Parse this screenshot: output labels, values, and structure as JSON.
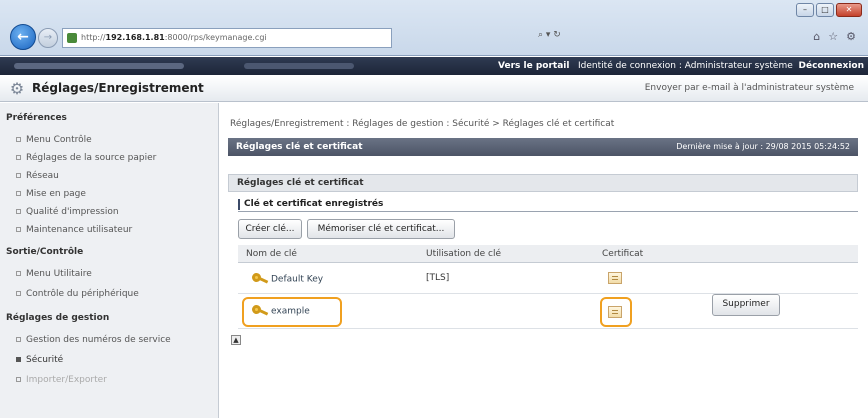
{
  "browser": {
    "url_prefix": "http://",
    "url_host": "192.168.1.81",
    "url_rest": ":8000/rps/keymanage.cgi",
    "address_tools": "⌕ ▾ ↻",
    "window_min": "–",
    "window_max": "□",
    "window_close": "✕",
    "back": "←",
    "forward": "→",
    "tools": [
      "⌂",
      "☆",
      "⚙"
    ]
  },
  "topbar": {
    "portal_link": "Vers le portail",
    "identity_label": "Identité de connexion : Administrateur système",
    "logout": "Déconnexion"
  },
  "titlebar": {
    "title": "Réglages/Enregistrement",
    "mail_link": "Envoyer par e-mail à l'administrateur système",
    "icon": "gear-icon"
  },
  "sidebar": {
    "categories": [
      {
        "label": "Préférences",
        "items": [
          "Menu Contrôle",
          "Réglages de la source papier",
          "Réseau",
          "Mise en page",
          "Qualité d'impression",
          "Maintenance utilisateur"
        ]
      },
      {
        "label": "Sortie/Contrôle",
        "items": [
          "Menu Utilitaire",
          "Contrôle du périphérique"
        ]
      },
      {
        "label": "Réglages de gestion",
        "items": [
          "Gestion des numéros de service",
          "Sécurité",
          "Importer/Exporter"
        ]
      }
    ]
  },
  "main": {
    "breadcrumb": "Réglages/Enregistrement : Réglages de gestion : Sécurité > Réglages clé et certificat",
    "header_title": "Réglages clé et certificat",
    "last_update": "Dernière mise à jour : 29/08 2015 05:24:52",
    "sub_header": "Réglages clé et certificat",
    "group_title": "Clé et certificat enregistrés",
    "create_button": "Créer clé...",
    "memorize_button": "Mémoriser clé et certificat...",
    "table": {
      "headers": [
        "Nom de clé",
        "Utilisation de clé",
        "Certificat"
      ],
      "rows": [
        {
          "name": "Default Key",
          "usage": "[TLS]"
        },
        {
          "name": "example",
          "usage": ""
        }
      ]
    },
    "delete_button": "Supprimer",
    "collapse_symbol": "▲"
  },
  "colors": {
    "highlight": "#f0a020",
    "header_bg": "#4c5466",
    "topbar_bg": "#1d2538"
  }
}
